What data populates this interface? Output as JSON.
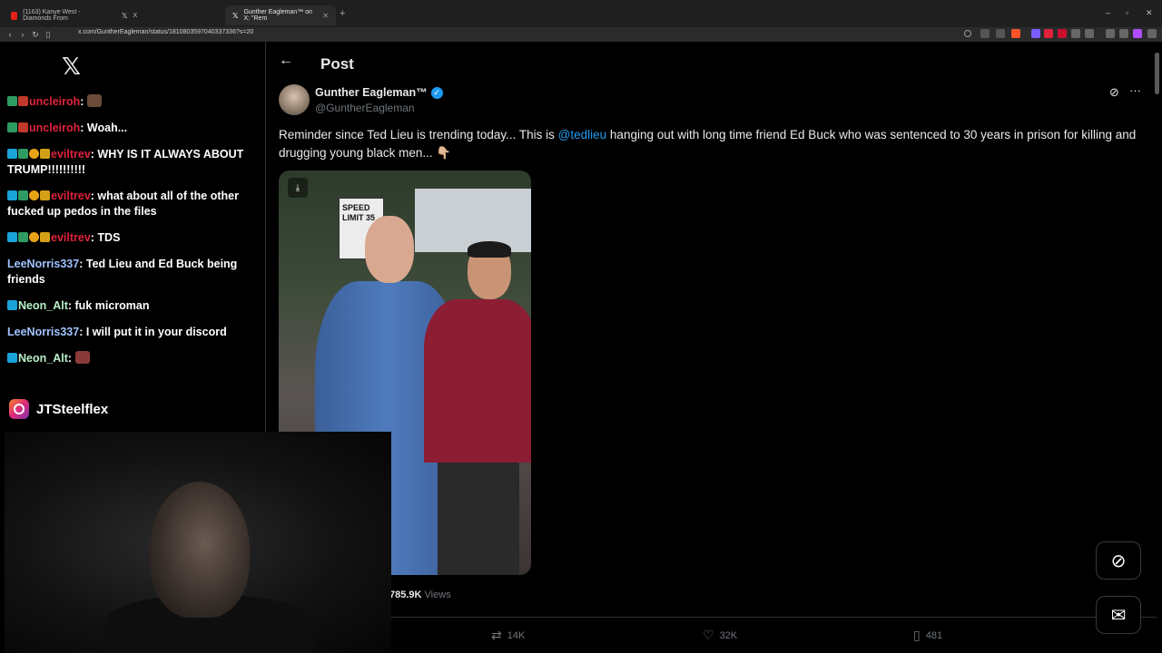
{
  "browser": {
    "tabs": [
      {
        "label": "(1163) Kanye West - Diamonds From",
        "favicon_color": "#e62117"
      },
      {
        "label": "X",
        "favicon_color": "#ffffff"
      },
      {
        "label": "Gunther Eagleman™ on X: \"Rem",
        "favicon_color": "#ffffff"
      }
    ],
    "new_tab": "+",
    "url": "x.com/GuntherEagleman/status/1810803597040337336?s=20",
    "window_controls": [
      "–",
      "▫",
      "✕"
    ]
  },
  "stream": {
    "chat": [
      {
        "user": "uncleiroh",
        "text": "",
        "user_color": "red",
        "emote": true
      },
      {
        "user": "uncleiroh",
        "text": "Woah...",
        "user_color": "red",
        "emote": false
      },
      {
        "user": "eviltrev",
        "text": "WHY IS IT ALWAYS ABOUT TRUMP!!!!!!!!!!",
        "user_color": "red",
        "emote": false
      },
      {
        "user": "eviltrev",
        "text": "what about all of the other fucked up pedos in the files",
        "user_color": "red",
        "emote": false
      },
      {
        "user": "eviltrev",
        "text": "TDS",
        "user_color": "red",
        "emote": false
      },
      {
        "user": "LeeNorris337",
        "text": "Ted Lieu and Ed Buck being friends",
        "user_color": "blue",
        "emote": false
      },
      {
        "user": "Neon_Alt",
        "text": "fuk microman",
        "user_color": "green",
        "emote": false
      },
      {
        "user": "LeeNorris337",
        "text": "I will put it in your discord",
        "user_color": "blue",
        "emote": false
      },
      {
        "user": "Neon_Alt",
        "text": "",
        "user_color": "green",
        "emote": true
      }
    ],
    "instagram_handle": "JTSteelflex"
  },
  "post": {
    "header_title": "Post",
    "author_name": "Gunther Eagleman™",
    "author_handle": "@GuntherEagleman",
    "text_before": "Reminder since Ted Lieu is trending today... This is ",
    "mention": "@tedlieu",
    "text_after": " hanging out with long time friend Ed Buck who was sentenced to 30 years in prison for killing and drugging young black men... 👇🏼",
    "photo_sign": "SPEED LIMIT 35",
    "views_count": "785.9K",
    "views_label": "Views",
    "retweets": "14K",
    "likes": "32K",
    "bookmarks": "481"
  },
  "colors": {
    "accent": "#1d9bf0",
    "background": "#000000",
    "muted": "#71767b"
  }
}
